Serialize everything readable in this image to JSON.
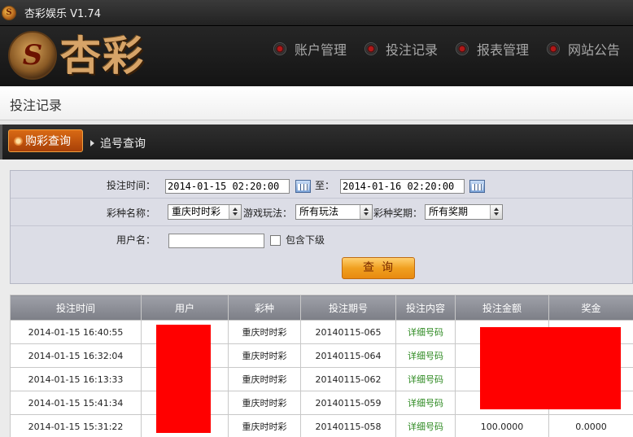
{
  "window": {
    "title": "杏彩娱乐 V1.74",
    "icon": "logo-emblem-icon"
  },
  "brand": {
    "logo_text": "杏彩",
    "emblem_glyph": "S"
  },
  "nav": {
    "items": [
      {
        "label": "账户管理"
      },
      {
        "label": "投注记录"
      },
      {
        "label": "报表管理"
      },
      {
        "label": "网站公告"
      }
    ]
  },
  "page": {
    "title": "投注记录"
  },
  "tabs": [
    {
      "label": "购彩查询",
      "active": true
    },
    {
      "label": "追号查询",
      "active": false
    }
  ],
  "filters": {
    "time_label": "投注时间：",
    "start_time": "2014-01-15 02:20:00",
    "to_label": "至：",
    "end_time": "2014-01-16 02:20:00",
    "lottery_label": "彩种名称：",
    "lottery_value": "重庆时时彩",
    "play_label": "游戏玩法：",
    "play_value": "所有玩法",
    "period_label": "彩种奖期：",
    "period_value": "所有奖期",
    "user_label": "用户名：",
    "user_value": "",
    "include_sub_label": "包含下级",
    "include_sub_checked": false,
    "query_button": "查询"
  },
  "table": {
    "headers": [
      "投注时间",
      "用户",
      "彩种",
      "投注期号",
      "投注内容",
      "投注金额",
      "奖金"
    ],
    "rows": [
      {
        "time": "2014-01-15 16:40:55",
        "user": "",
        "lottery": "重庆时时彩",
        "period": "20140115-065",
        "content": "详细号码",
        "amount": "",
        "bonus": ""
      },
      {
        "time": "2014-01-15 16:32:04",
        "user": "",
        "lottery": "重庆时时彩",
        "period": "20140115-064",
        "content": "详细号码",
        "amount": "",
        "bonus": ""
      },
      {
        "time": "2014-01-15 16:13:33",
        "user": "",
        "lottery": "重庆时时彩",
        "period": "20140115-062",
        "content": "详细号码",
        "amount": "",
        "bonus": ""
      },
      {
        "time": "2014-01-15 15:41:34",
        "user": "",
        "lottery": "重庆时时彩",
        "period": "20140115-059",
        "content": "详细号码",
        "amount": "",
        "bonus": ""
      },
      {
        "time": "2014-01-15 15:31:22",
        "user": "",
        "lottery": "重庆时时彩",
        "period": "20140115-058",
        "content": "详细号码",
        "amount": "100.0000",
        "bonus": "0.0000"
      }
    ]
  },
  "colors": {
    "accent": "#e88a10",
    "link": "#2e8a22",
    "redaction": "#ff0000"
  }
}
